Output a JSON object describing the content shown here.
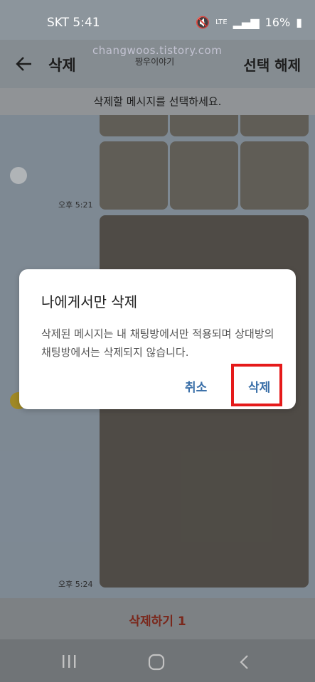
{
  "status": {
    "carrier_time": "SKT 5:41",
    "battery": "16%",
    "signal": "LTE"
  },
  "header": {
    "title": "삭제",
    "deselect": "선택 해제",
    "watermark": "changwoos.tistory.com",
    "chat_name": "짱우이야기"
  },
  "instruction": "삭제할 메시지를 선택하세요.",
  "chat": {
    "times": [
      "오후 5:21",
      "오후 5:24"
    ]
  },
  "bottom": {
    "delete_button": "삭제하기",
    "count": "1"
  },
  "dialog": {
    "title": "나에게서만 삭제",
    "body": "삭제된 메시지는 내 채팅방에서만 적용되며 상대방의 채팅방에서는 삭제되지 않습니다.",
    "cancel": "취소",
    "confirm": "삭제"
  },
  "colors": {
    "accent": "#3a6fa8",
    "highlight": "#e51a1a",
    "delete_text": "#8b2d1f"
  }
}
